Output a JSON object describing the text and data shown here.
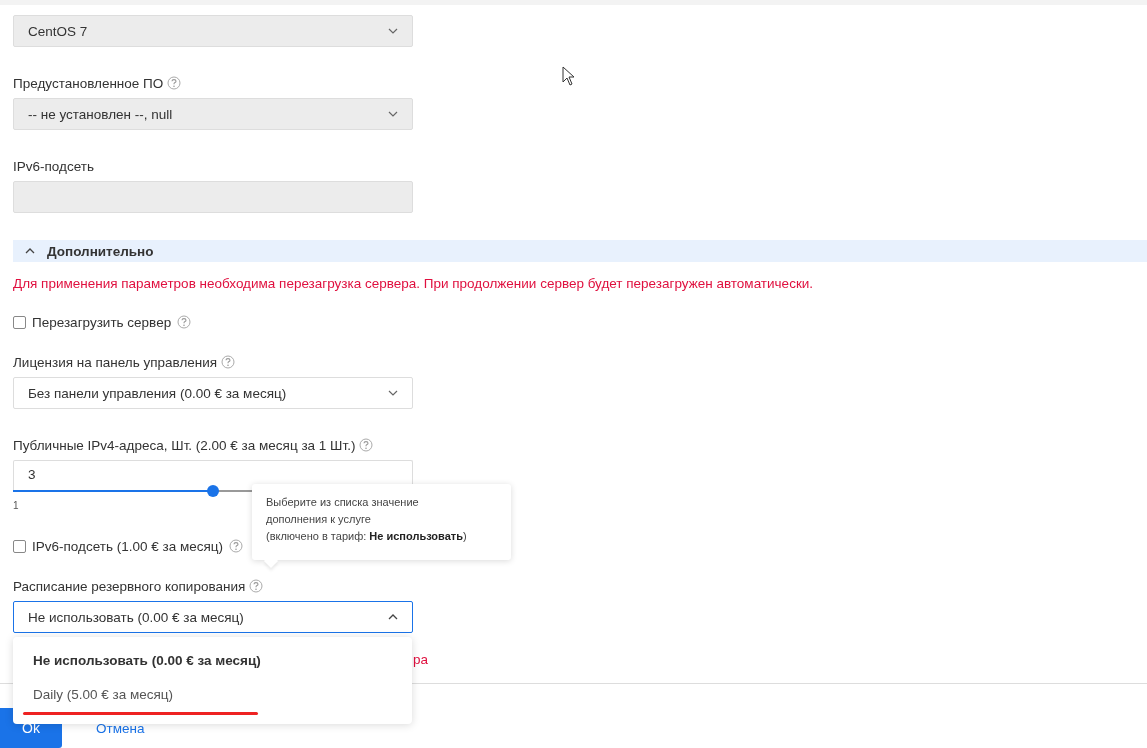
{
  "form": [
    {
      "kind": "select",
      "value": "CentOS 7",
      "disabled": true,
      "open": false
    },
    {
      "kind": "select",
      "label": "Предустановленное ПО",
      "help": true,
      "value": "-- не установлен --,  null",
      "disabled": true,
      "open": false
    },
    {
      "kind": "input",
      "label": "IPv6-подсеть",
      "disabled": true
    },
    {
      "kind": "section",
      "label": "Дополнительно",
      "expanded": true
    },
    {
      "kind": "notice",
      "text": "Для применения параметров необходима перезагрузка сервера. При продолжении сервер будет перезагружен автоматически."
    },
    {
      "kind": "checkbox",
      "label": "Перезагрузить сервер",
      "help": true,
      "checked": false
    },
    {
      "kind": "select",
      "label": "Лицензия на панель управления",
      "help": true,
      "value": "Без панели управления (0.00 € за месяц)",
      "disabled": false,
      "open": false
    },
    {
      "kind": "slider",
      "label": "Публичные IPv4-адреса, Шт. (2.00 € за месяц за 1 Шт.)",
      "help": true,
      "value": "3",
      "min_label": "1",
      "level": 0.5
    },
    {
      "kind": "checkbox",
      "label": "IPv6-подсеть (1.00 € за месяц)",
      "help": true,
      "checked": false
    },
    {
      "kind": "select",
      "label": "Расписание резервного копирования",
      "help": true,
      "value": "Не использовать (0.00 € за месяц)",
      "disabled": false,
      "open": true
    }
  ],
  "hidden_notice_tail": "ра",
  "tooltip": {
    "text": "Выберите из списка значение\nдополнения к услуге\n(включено в тариф: **Не использовать**)"
  },
  "dropdown": {
    "options": [
      {
        "label": "Не использовать (0.00 € за месяц)",
        "selected": true,
        "underlined": false
      },
      {
        "label": "Daily (5.00 € за месяц)",
        "selected": false,
        "underlined": true
      }
    ]
  },
  "footer": {
    "ok": "Ok",
    "cancel": "Отмена"
  }
}
